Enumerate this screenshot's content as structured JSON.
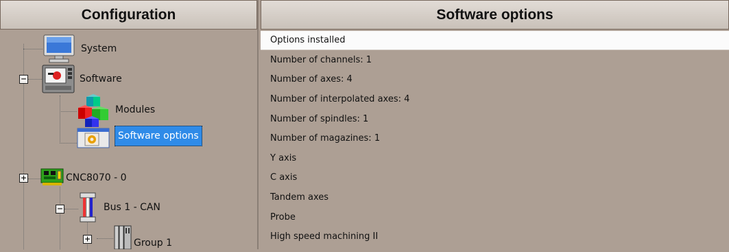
{
  "left_panel": {
    "title": "Configuration",
    "tree": {
      "system": "System",
      "software": "Software",
      "modules": "Modules",
      "software_options": "Software options",
      "cnc": "CNC8070 - 0",
      "bus": "Bus 1 - CAN",
      "group": "Group 1"
    },
    "expand_symbol": "+",
    "collapse_symbol": "−"
  },
  "right_panel": {
    "title": "Software options",
    "list_header": "Options installed",
    "options": [
      "Number of channels: 1",
      "Number of axes: 4",
      "Number of interpolated axes: 4",
      "Number of spindles: 1",
      "Number of magazines: 1",
      "Y axis",
      "C axis",
      "Tandem axes",
      "Probe",
      "High speed machining II"
    ]
  },
  "colors": {
    "panel_bg": "#ad9f94",
    "selection": "#2f8be8",
    "header_bg": "#d8d1ca"
  }
}
